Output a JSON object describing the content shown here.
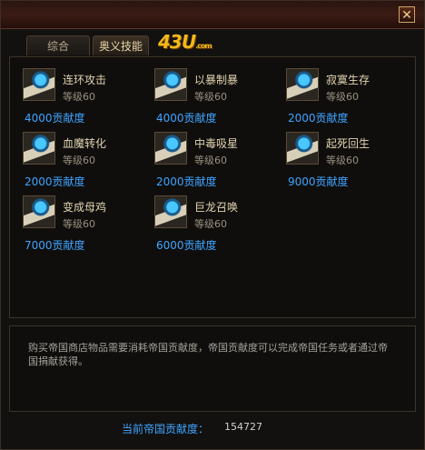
{
  "window": {
    "close_symbol": "✕"
  },
  "tabs": [
    {
      "label": "综合"
    },
    {
      "label": "奥义技能"
    }
  ],
  "logo": {
    "main": "43U",
    "sub": ".com"
  },
  "skills": [
    {
      "name": "连环攻击",
      "level": "等级60",
      "cost": "4000贡献度",
      "icon": "skill-book-icon"
    },
    {
      "name": "以暴制暴",
      "level": "等级60",
      "cost": "4000贡献度",
      "icon": "skill-book-icon"
    },
    {
      "name": "寂寞生存",
      "level": "等级60",
      "cost": "2000贡献度",
      "icon": "skill-book-icon"
    },
    {
      "name": "血魔转化",
      "level": "等级60",
      "cost": "2000贡献度",
      "icon": "skill-book-icon"
    },
    {
      "name": "中毒吸星",
      "level": "等级60",
      "cost": "2000贡献度",
      "icon": "skill-book-icon"
    },
    {
      "name": "起死回生",
      "level": "等级60",
      "cost": "9000贡献度",
      "icon": "skill-book-icon"
    },
    {
      "name": "变成母鸡",
      "level": "等级60",
      "cost": "7000贡献度",
      "icon": "skill-book-icon"
    },
    {
      "name": "巨龙召唤",
      "level": "等级60",
      "cost": "6000贡献度",
      "icon": "skill-book-icon"
    }
  ],
  "description": "购买帝国商店物品需要消耗帝国贡献度，帝国贡献度可以完成帝国任务或者通过帝国捐献获得。",
  "footer": {
    "label": "当前帝国贡献度：",
    "value": "154727"
  }
}
